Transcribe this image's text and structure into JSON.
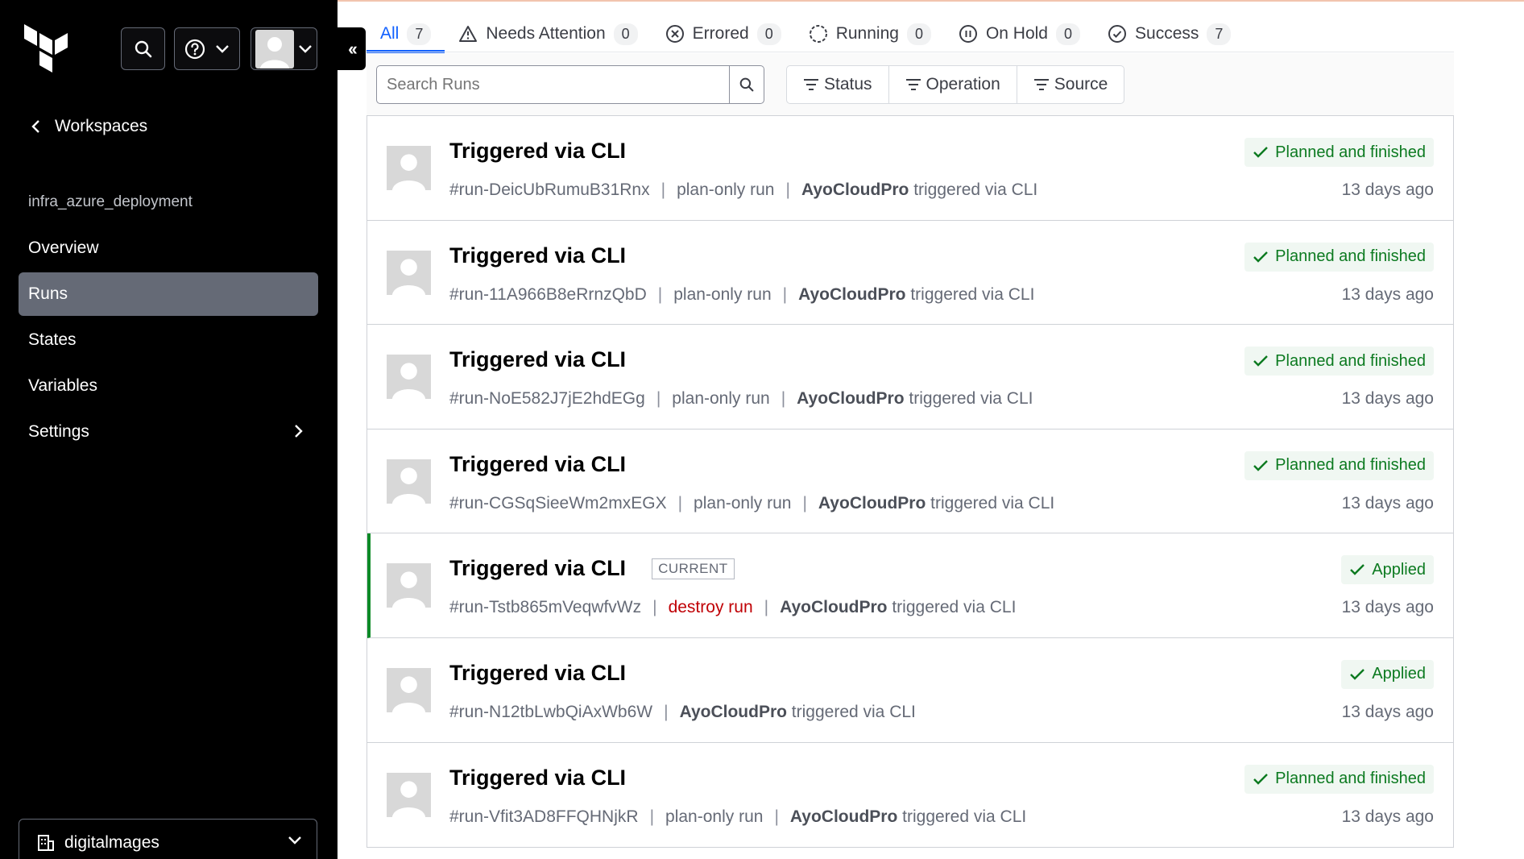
{
  "sidebar": {
    "back_label": "Workspaces",
    "workspace_name": "infra_azure_deployment",
    "nav": [
      {
        "label": "Overview"
      },
      {
        "label": "Runs"
      },
      {
        "label": "States"
      },
      {
        "label": "Variables"
      },
      {
        "label": "Settings"
      }
    ],
    "org_name": "digitalmages"
  },
  "tabs": [
    {
      "label": "All",
      "count": "7",
      "icon": "none"
    },
    {
      "label": "Needs Attention",
      "count": "0",
      "icon": "warning-icon"
    },
    {
      "label": "Errored",
      "count": "0",
      "icon": "x-circle-icon"
    },
    {
      "label": "Running",
      "count": "0",
      "icon": "loading-icon"
    },
    {
      "label": "On Hold",
      "count": "0",
      "icon": "pause-circle-icon"
    },
    {
      "label": "Success",
      "count": "7",
      "icon": "check-circle-icon"
    }
  ],
  "search": {
    "placeholder": "Search Runs"
  },
  "filters": [
    {
      "label": "Status"
    },
    {
      "label": "Operation"
    },
    {
      "label": "Source"
    }
  ],
  "colors": {
    "accent": "#1060ff",
    "success": "#0c7a20",
    "danger": "#c00005",
    "sidebar": "#000000"
  },
  "runs": [
    {
      "title": "Triggered via CLI",
      "id": "#run-DeicUbRumuB31Rnx",
      "type": "plan-only run",
      "author": "AyoCloudPro",
      "source": "triggered via CLI",
      "status": "Planned and finished",
      "time": "13 days ago"
    },
    {
      "title": "Triggered via CLI",
      "id": "#run-11A966B8eRrnzQbD",
      "type": "plan-only run",
      "author": "AyoCloudPro",
      "source": "triggered via CLI",
      "status": "Planned and finished",
      "time": "13 days ago"
    },
    {
      "title": "Triggered via CLI",
      "id": "#run-NoE582J7jE2hdEGg",
      "type": "plan-only run",
      "author": "AyoCloudPro",
      "source": "triggered via CLI",
      "status": "Planned and finished",
      "time": "13 days ago"
    },
    {
      "title": "Triggered via CLI",
      "id": "#run-CGSqSieeWm2mxEGX",
      "type": "plan-only run",
      "author": "AyoCloudPro",
      "source": "triggered via CLI",
      "status": "Planned and finished",
      "time": "13 days ago"
    },
    {
      "title": "Triggered via CLI",
      "badge": "CURRENT",
      "id": "#run-Tstb865mVeqwfvWz",
      "type": "destroy run",
      "author": "AyoCloudPro",
      "source": "triggered via CLI",
      "status": "Applied",
      "time": "13 days ago"
    },
    {
      "title": "Triggered via CLI",
      "id": "#run-N12tbLwbQiAxWb6W",
      "author": "AyoCloudPro",
      "source": "triggered via CLI",
      "status": "Applied",
      "time": "13 days ago"
    },
    {
      "title": "Triggered via CLI",
      "id": "#run-Vfit3AD8FFQHNjkR",
      "type": "plan-only run",
      "author": "AyoCloudPro",
      "source": "triggered via CLI",
      "status": "Planned and finished",
      "time": "13 days ago"
    }
  ]
}
